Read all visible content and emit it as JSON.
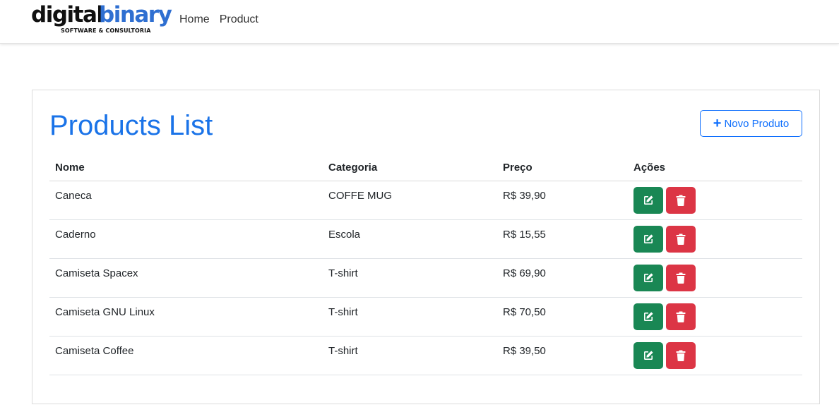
{
  "brand": {
    "name_part1": "digital",
    "name_part2": "binary",
    "tagline": "SOFTWARE & CONSULTORIA"
  },
  "nav": {
    "items": [
      {
        "label": "Home"
      },
      {
        "label": "Product"
      }
    ]
  },
  "colors": {
    "brand_blue": "#2f6fd1",
    "title_blue": "#1a73e8",
    "primary": "#0d6efd",
    "success": "#198754",
    "danger": "#dc3545"
  },
  "main": {
    "title": "Products List",
    "new_button": {
      "icon": "plus-icon",
      "label": "Novo Produto"
    },
    "table": {
      "headers": [
        "Nome",
        "Categoria",
        "Preço",
        "Ações"
      ],
      "rows": [
        {
          "nome": "Caneca",
          "categoria": "COFFE MUG",
          "preco": "R$ 39,90"
        },
        {
          "nome": "Caderno",
          "categoria": "Escola",
          "preco": "R$ 15,55"
        },
        {
          "nome": "Camiseta Spacex",
          "categoria": "T-shirt",
          "preco": "R$ 69,90"
        },
        {
          "nome": "Camiseta GNU Linux",
          "categoria": "T-shirt",
          "preco": "R$ 70,50"
        },
        {
          "nome": "Camiseta Coffee",
          "categoria": "T-shirt",
          "preco": "R$ 39,50"
        }
      ],
      "row_actions": [
        {
          "name": "edit",
          "icon": "edit-icon"
        },
        {
          "name": "delete",
          "icon": "trash-icon"
        }
      ]
    }
  }
}
